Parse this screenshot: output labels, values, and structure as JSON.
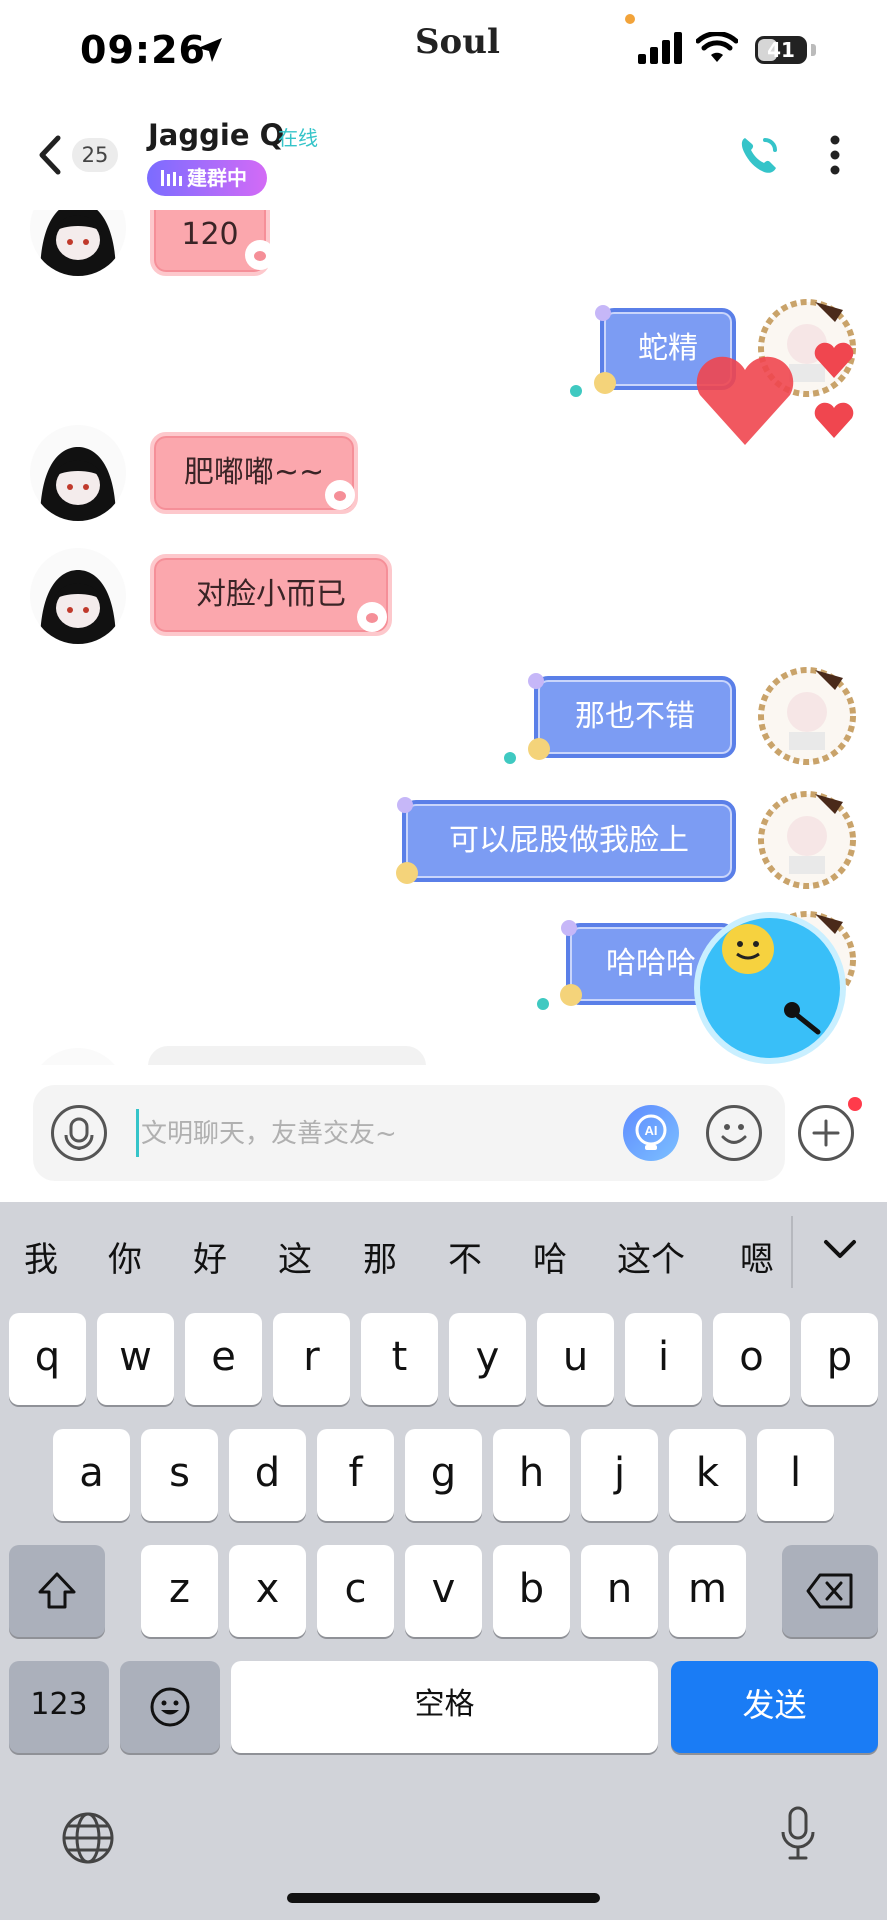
{
  "status_bar": {
    "time": "09:26",
    "carrier": "Soul",
    "battery_level": "41",
    "battery_fraction": 0.41,
    "icons": [
      "location-arrow-icon",
      "signal-icon",
      "wifi-icon",
      "battery-icon"
    ]
  },
  "header": {
    "unread_count": "25",
    "peer_name": "Jaggie Q",
    "peer_status": "在线",
    "group_badge": "建群中",
    "icons": [
      "back-chevron-icon",
      "phone-call-icon",
      "more-vertical-icon"
    ],
    "accent_color": "#35c4c9"
  },
  "messages": [
    {
      "side": "left",
      "text": "120"
    },
    {
      "side": "right",
      "text": "蛇精"
    },
    {
      "side": "left",
      "text": "肥嘟嘟~~"
    },
    {
      "side": "left",
      "text": "对脸小而已"
    },
    {
      "side": "right",
      "text": "那也不错"
    },
    {
      "side": "right",
      "text": "可以屁股做我脸上"
    },
    {
      "side": "right",
      "text": "哈哈哈"
    }
  ],
  "input_bar": {
    "placeholder": "文明聊天，友善交友~",
    "ai_label": "AI",
    "icons": [
      "voice-icon",
      "ai-bulb-icon",
      "emoji-icon",
      "plus-icon"
    ]
  },
  "keyboard": {
    "candidates": [
      "我",
      "你",
      "好",
      "这",
      "那",
      "不",
      "哈",
      "这个",
      "嗯"
    ],
    "row1": [
      "q",
      "w",
      "e",
      "r",
      "t",
      "y",
      "u",
      "i",
      "o",
      "p"
    ],
    "row2": [
      "a",
      "s",
      "d",
      "f",
      "g",
      "h",
      "j",
      "k",
      "l"
    ],
    "row3": [
      "z",
      "x",
      "c",
      "v",
      "b",
      "n",
      "m"
    ],
    "num_label": "123",
    "space_label": "空格",
    "send_label": "发送",
    "send_color": "#1a7cf5",
    "icons": [
      "shift-icon",
      "backspace-icon",
      "emoji-key-icon",
      "globe-icon",
      "microphone-icon",
      "collapse-chevron-icon"
    ]
  }
}
